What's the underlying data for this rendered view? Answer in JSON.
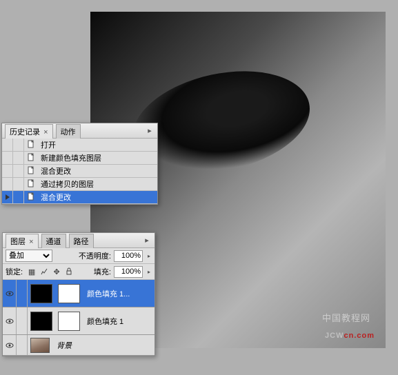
{
  "canvas": {
    "watermark_en": "JCW",
    "watermark_en2": "cn.com",
    "watermark_cn": "中国教程网"
  },
  "history": {
    "tab_history": "历史记录",
    "tab_actions": "动作",
    "items": [
      {
        "label": "打开",
        "icon": "document-icon"
      },
      {
        "label": "新建颜色填充图层",
        "icon": "document-icon"
      },
      {
        "label": "混合更改",
        "icon": "document-icon"
      },
      {
        "label": "通过拷贝的图层",
        "icon": "document-icon"
      },
      {
        "label": "混合更改",
        "icon": "document-icon",
        "selected": true
      }
    ]
  },
  "layers": {
    "tab_layers": "图层",
    "tab_channels": "通道",
    "tab_paths": "路径",
    "blend_mode": "叠加",
    "opacity_label": "不透明度:",
    "opacity_value": "100%",
    "lock_label": "锁定:",
    "fill_label": "填充:",
    "fill_value": "100%",
    "rows": [
      {
        "name": "颜色填充 1...",
        "selected": true
      },
      {
        "name": "颜色填充 1",
        "selected": false
      },
      {
        "name": "背景",
        "selected": false,
        "bg": true
      }
    ]
  }
}
